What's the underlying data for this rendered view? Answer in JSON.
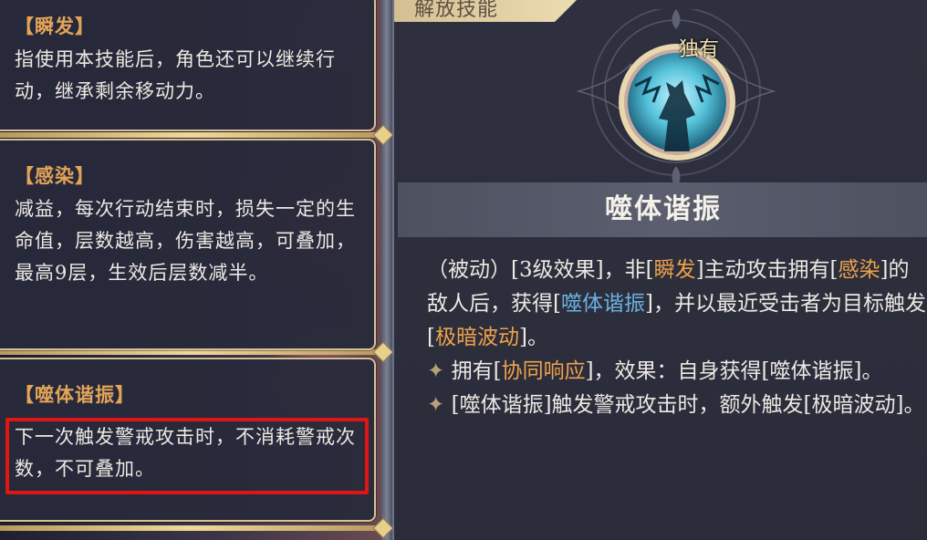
{
  "left_cards": [
    {
      "title": "【瞬发】",
      "desc": "指使用本技能后，角色还可以继续行动，继承剩余移动力。"
    },
    {
      "title": "【感染】",
      "desc": "减益，每次行动结束时，损失一定的生命值，层数越高，伤害越高，可叠加，最高9层，生效后层数减半。"
    },
    {
      "title": "【噬体谐振】",
      "desc": "下一次触发警戒攻击时，不消耗警戒次数，不可叠加。"
    }
  ],
  "right_panel": {
    "section_tab": "解放技能",
    "unique_badge": "独有",
    "skill_name": "噬体谐振",
    "desc": {
      "p1": [
        "（被动）[3级效果]，非[",
        "瞬发",
        "]主动攻击拥有[",
        "感染",
        "]的敌人后，获得[",
        "噬体谐振",
        "]，并以最近受击者为目标触发[",
        "极暗波动",
        "]。"
      ],
      "p2": [
        "✦",
        " 拥有[",
        "协同响应",
        "]，效果：自身获得[噬体谐振]。"
      ],
      "p3": [
        "✦",
        " [噬体谐振]触发警戒攻击时，额外触发[极暗波动]。"
      ]
    }
  },
  "colors": {
    "keyword_orange": "#f0a24a",
    "keyword_blue": "#6cb1e0",
    "highlight_box": "#e01515",
    "card_border": "#d7c197"
  },
  "icons": {
    "skill_icon": "shadow-figure-icon",
    "bullet_icon": "four-point-star-icon"
  }
}
